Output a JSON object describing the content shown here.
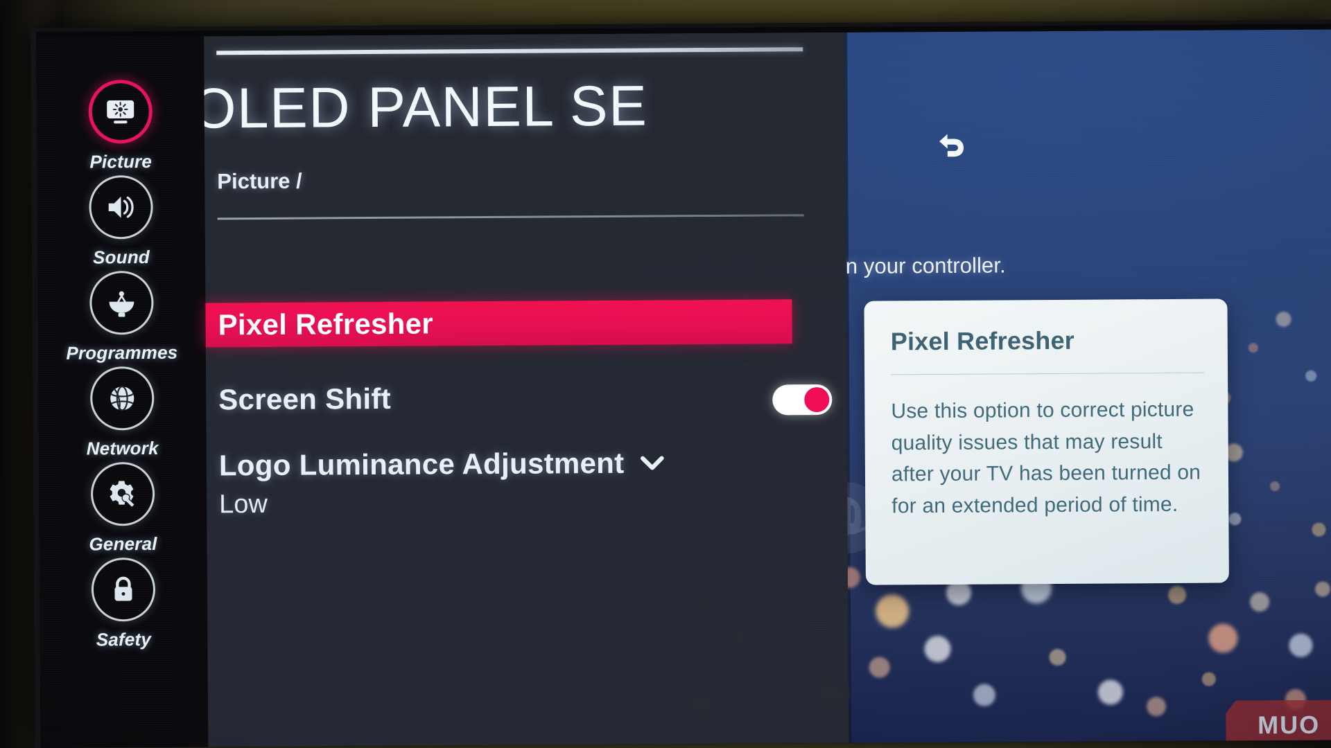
{
  "tv_menu": {
    "title": "OLED PANEL SE",
    "title_full": "OLED PANEL SETTINGS",
    "breadcrumb": "Picture /",
    "back_icon": "back-arrow-icon",
    "accent_color": "#ea0f53",
    "sidebar": {
      "items": [
        {
          "label": "Picture",
          "icon": "picture-brightness-icon",
          "active": true
        },
        {
          "label": "Sound",
          "icon": "speaker-icon",
          "active": false
        },
        {
          "label": "Programmes",
          "icon": "satellite-dish-icon",
          "active": false
        },
        {
          "label": "Network",
          "icon": "globe-icon",
          "active": false
        },
        {
          "label": "General",
          "icon": "gear-wrench-icon",
          "active": false
        },
        {
          "label": "Safety",
          "icon": "padlock-icon",
          "active": false
        }
      ]
    },
    "rows": [
      {
        "label": "Pixel Refresher",
        "selected": true,
        "control": "none"
      },
      {
        "label": "Screen Shift",
        "selected": false,
        "control": "toggle",
        "toggle_state": "on"
      },
      {
        "label": "Logo Luminance Adjustment",
        "selected": false,
        "control": "dropdown",
        "value": "Low",
        "chevron": "chevron-down-icon"
      }
    ]
  },
  "ps_console": {
    "hint": "Press the PS button on your controller.",
    "logo_icon": "playstation-logo-icon",
    "card": {
      "title": "Pixel Refresher",
      "body": "Use this option to correct picture quality issues that may result after your TV has been turned on for an extended period of time."
    }
  },
  "watermark": {
    "label": "MUO"
  }
}
